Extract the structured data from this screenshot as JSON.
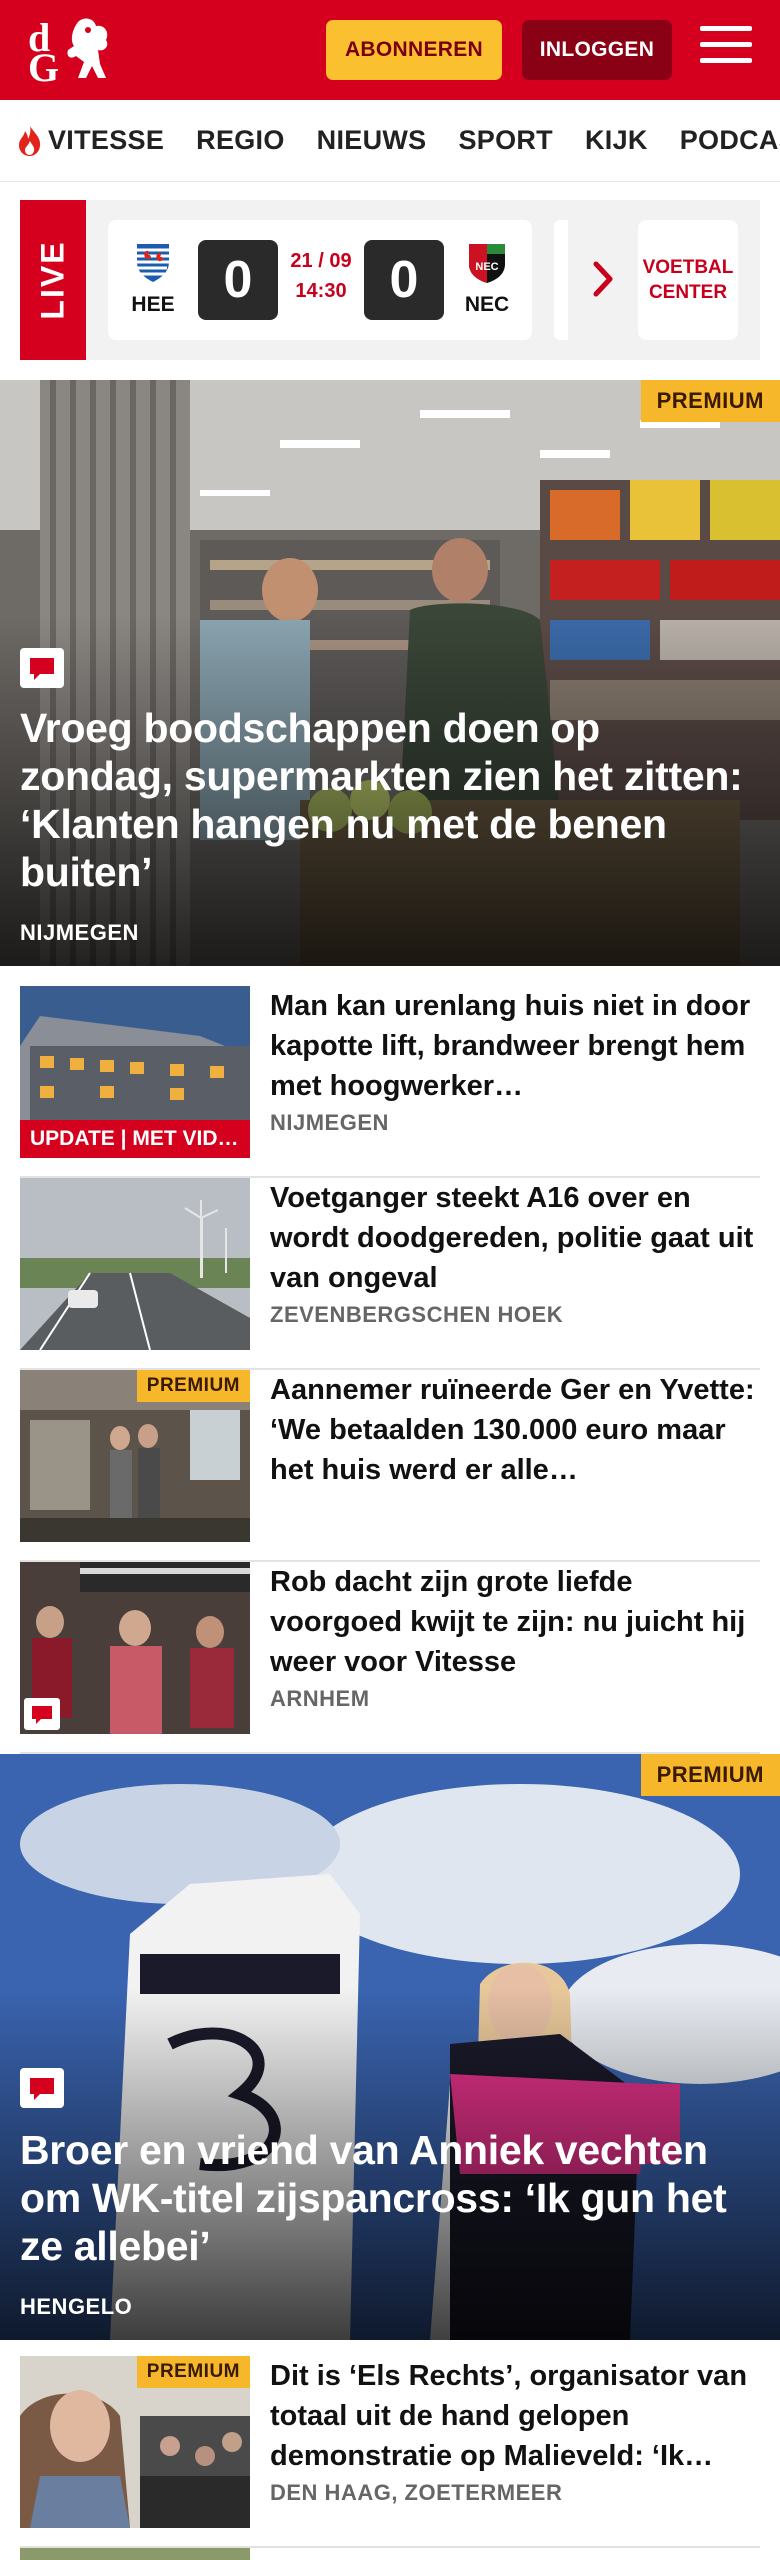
{
  "header": {
    "brand_top": "d",
    "brand_bottom": "G",
    "subscribe_label": "ABONNEREN",
    "login_label": "INLOGGEN",
    "brand_color": "#d4001e"
  },
  "nav": {
    "items": [
      "VITESSE",
      "REGIO",
      "NIEUWS",
      "SPORT",
      "KIJK",
      "PODCAST"
    ]
  },
  "live": {
    "tag": "LIVE",
    "match": {
      "home": "HEE",
      "away": "NEC",
      "home_score": "0",
      "away_score": "0",
      "date": "21 / 09",
      "time": "14:30"
    },
    "voetbal_center": "VOETBAL CENTER"
  },
  "hero1": {
    "badge": "PREMIUM",
    "title": "Vroeg boodschappen doen op zondag, supermarkten zien het zitten: ‘Klanten hangen nu met de benen buiten’",
    "location": "NIJMEGEN"
  },
  "articles1": [
    {
      "title": "Man kan urenlang huis niet in door kapotte lift, brandweer brengt hem met hoogwerker…",
      "location": "NIJMEGEN",
      "label": "UPDATE | MET VID…"
    },
    {
      "title": "Voetganger steekt A16 over en wordt doodgereden, politie gaat uit van ongeval",
      "location": "ZEVENBERGSCHEN HOEK"
    },
    {
      "title": "Aannemer ruïneerde Ger en Yvette: ‘We betaalden 130.000 euro maar het huis werd er alle…",
      "location": "",
      "badge": "PREMIUM"
    },
    {
      "title": "Rob dacht zijn grote liefde voorgoed kwijt te zijn: nu juicht hij weer voor Vitesse",
      "location": "ARNHEM"
    }
  ],
  "hero2": {
    "badge": "PREMIUM",
    "title": "Broer en vriend van Anniek vechten om WK-titel zijspancross: ‘Ik gun het ze allebei’",
    "location": "HENGELO"
  },
  "articles2": [
    {
      "title": "Dit is ‘Els Rechts’, organisator van totaal uit de hand gelopen demonstratie op Malieveld: ‘Ik…",
      "location": "DEN HAAG, ZOETERMEER",
      "badge": "PREMIUM"
    }
  ]
}
